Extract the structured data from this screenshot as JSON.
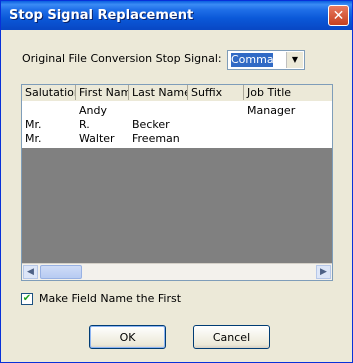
{
  "window": {
    "title": "Stop Signal Replacement",
    "close_symbol": "✕"
  },
  "signal": {
    "label": "Original File Conversion Stop Signal:",
    "selected_value": "Comma",
    "dropdown_arrow": "▼"
  },
  "table": {
    "columns": [
      "Salutation",
      "First Name",
      "Last Name",
      "Suffix",
      "Job Title"
    ],
    "rows": [
      [
        "",
        "Andy",
        "",
        "",
        "Manager"
      ],
      [
        "Mr.",
        "R.",
        "Becker",
        "",
        ""
      ],
      [
        "Mr.",
        "Walter",
        "Freeman",
        "",
        ""
      ]
    ],
    "scroll_left_symbol": "◀",
    "scroll_right_symbol": "▶"
  },
  "options": {
    "make_field_name_first_label": "Make Field Name the First",
    "make_field_name_first_checked": true,
    "check_mark": "✔"
  },
  "buttons": {
    "ok_label": "OK",
    "cancel_label": "Cancel"
  },
  "colors": {
    "titlebar": "#0a58d8",
    "dialog_bg": "#ece9d8",
    "selection": "#316ac5",
    "empty_list_bg": "#808080"
  }
}
